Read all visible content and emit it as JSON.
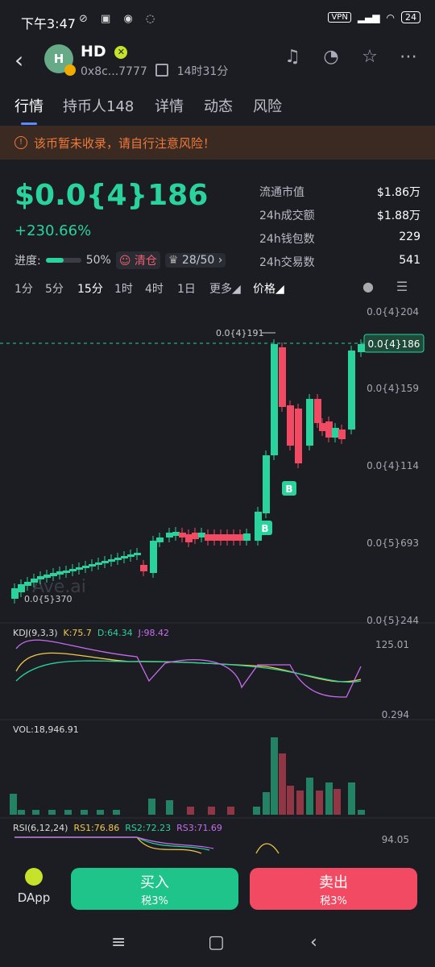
{
  "status_bar": {
    "time": "下午3:47",
    "vpn": "VPN",
    "network": "HD",
    "battery": "24"
  },
  "token": {
    "avatar_letter": "H",
    "name": "HD",
    "address": "0x8c...7777",
    "age": "14时31分"
  },
  "tabs": [
    "行情",
    "持币人148",
    "详情",
    "动态",
    "风险"
  ],
  "warning": "该币暂未收录，请自行注意风险！",
  "price": "$0.0{4}186",
  "change": "+230.66%",
  "progress": {
    "label": "进度:",
    "percent_text": "50%",
    "value": 0.5,
    "tag1": "清仓",
    "tag2": "28/50"
  },
  "stats": [
    {
      "label": "流通市值",
      "value": "$1.86万"
    },
    {
      "label": "24h成交额",
      "value": "$1.88万"
    },
    {
      "label": "24h钱包数",
      "value": "229"
    },
    {
      "label": "24h交易数",
      "value": "541"
    }
  ],
  "intervals": [
    "1分",
    "5分",
    "15分",
    "1时",
    "4时",
    "1日",
    "更多",
    "价格"
  ],
  "chart": {
    "price_axis": [
      "0.0{4}204",
      "0.0{4}159",
      "0.0{4}114",
      "0.0{5}693",
      "0.0{5}244"
    ],
    "current_price": "0.0{4}186",
    "high_label": "0.0{4}191",
    "low_label": "0.0{5}370",
    "watermark": "Ave.ai",
    "buy_marker": "B",
    "kdj": {
      "label": "KDJ(9,3,3)",
      "k": "K:75.7",
      "d": "D:64.34",
      "j": "J:98.42",
      "axis_top": "125.01",
      "axis_bottom": "0.294"
    },
    "vol": {
      "label": "VOL:18,946.91"
    },
    "rsi": {
      "label": "RSI(6,12,24)",
      "rs1": "RS1:76.86",
      "rs2": "RS2:72.23",
      "rs3": "RS3:71.69",
      "axis_top": "94.05"
    }
  },
  "bottom": {
    "dapp": "DApp",
    "buy": "买入",
    "buy_tax": "税3%",
    "sell": "卖出",
    "sell_tax": "税3%"
  },
  "colors": {
    "up": "#29d39b",
    "down": "#f24a63",
    "k_line": "#f2c94c",
    "d_line": "#29d39b",
    "j_line": "#c86cf0"
  }
}
